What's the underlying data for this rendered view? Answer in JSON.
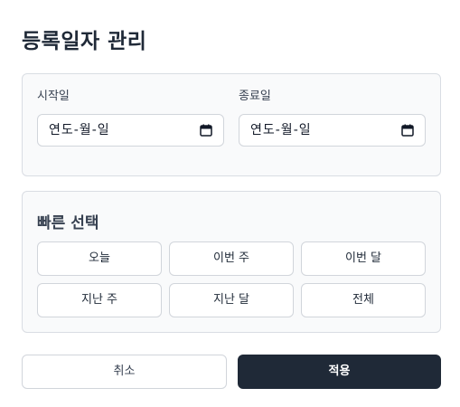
{
  "dialog": {
    "title": "등록일자 관리"
  },
  "date_range": {
    "start": {
      "label": "시작일",
      "placeholder": "연도-월-일",
      "icon": "calendar-icon"
    },
    "end": {
      "label": "종료일",
      "placeholder": "연도-월-일",
      "icon": "calendar-icon"
    }
  },
  "quick_select": {
    "title": "빠른 선택",
    "options": [
      "오늘",
      "이번 주",
      "이번 달",
      "지난 주",
      "지난 달",
      "전체"
    ]
  },
  "footer": {
    "cancel_label": "취소",
    "apply_label": "적용"
  },
  "colors": {
    "primary": "#1f2937",
    "panel_bg": "#f9fafb",
    "border": "#d1d5db"
  }
}
